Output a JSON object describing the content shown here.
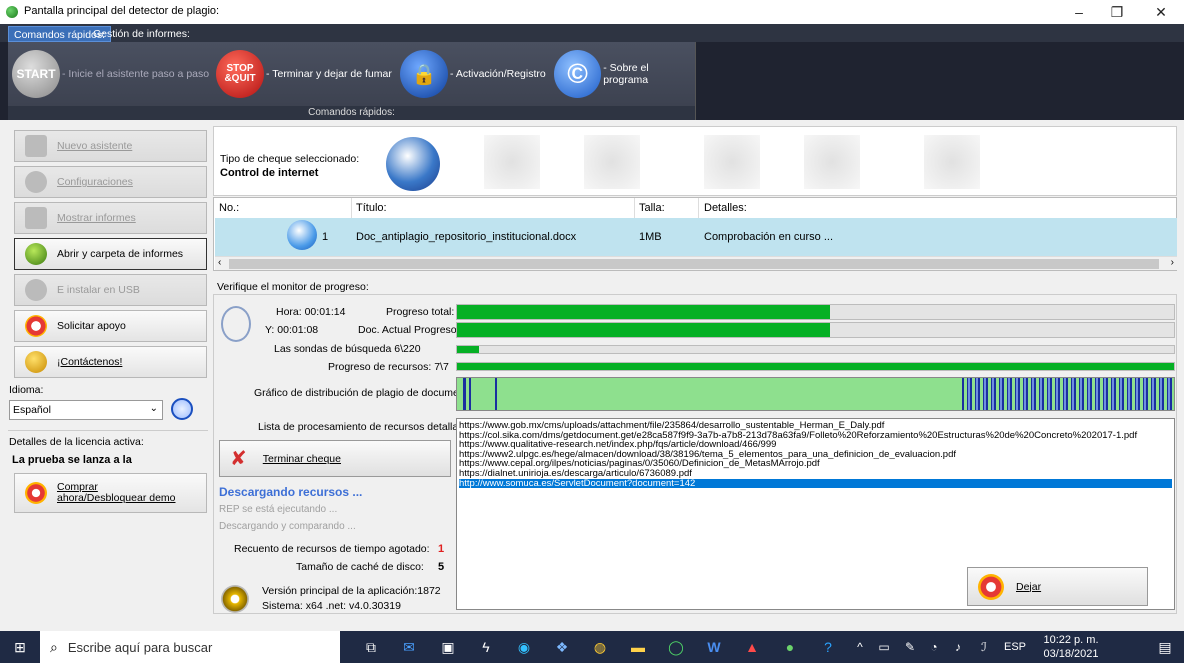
{
  "window": {
    "title": "Pantalla principal del detector de plagio:",
    "minimize": "–",
    "restore": "❐",
    "close": "✕"
  },
  "ribbon": {
    "tabs": [
      "Comandos rápidos:",
      "Gestión de informes:"
    ],
    "group_label": "Comandos rápidos:",
    "commands": [
      {
        "icon": "START",
        "label": "- Inicie el asistente paso a paso"
      },
      {
        "icon": "STOP &QUIT",
        "label": "- Terminar y dejar de fumar"
      },
      {
        "icon": "lock-icon",
        "label": "- Activación/Registro"
      },
      {
        "icon": "copyright-icon",
        "label": "- Sobre el programa"
      }
    ]
  },
  "sidebar": {
    "items": [
      {
        "label": "Nuevo asistente"
      },
      {
        "label": "Configuraciones"
      },
      {
        "label": "Mostrar informes"
      },
      {
        "label": "Abrir y carpeta de informes"
      },
      {
        "label": "E instalar en USB"
      },
      {
        "label": "Solicitar apoyo"
      },
      {
        "label": "¡Contáctenos!"
      }
    ],
    "language_label": "Idioma:",
    "language_value": "Español",
    "license_label": "Detalles de la licencia activa:",
    "license_value": "La prueba se lanza a la",
    "buy_label": "Comprar ahora/Desbloquear demo"
  },
  "check": {
    "type_label": "Tipo de cheque seleccionado:",
    "type_value": "Control de internet"
  },
  "table": {
    "headers": [
      "No.:",
      "Título:",
      "Talla:",
      "Detalles:"
    ],
    "rows": [
      {
        "no": "1",
        "title": "Doc_antiplagio_repositorio_institucional.docx",
        "size": "1MB",
        "details": "Comprobación en curso ..."
      }
    ]
  },
  "monitor": {
    "label": "Verifique el monitor de progreso:",
    "time_label": "Hora: 00:01:14",
    "y_label": "Y: 00:01:08",
    "total_progress_label": "Progreso total:",
    "total_progress": 0.52,
    "doc_progress_label": "Doc. Actual Progreso:",
    "doc_progress": 0.52,
    "probes_label": "Las sondas de búsqueda  6\\220",
    "probes_progress": 0.03,
    "resources_label": "Progreso de recursos:  7\\7",
    "resources_progress": 1.0,
    "distribution_label": "Gráfico de distribución de plagio de documentos",
    "list_label": "Lista de procesamiento de recursos detallados:",
    "resources": [
      "https://www.gob.mx/cms/uploads/attachment/file/235864/desarrollo_sustentable_Herman_E_Daly.pdf",
      "https://col.sika.com/dms/getdocument.get/e28ca587f9f9-3a7b-a7b8-213d78a63fa9/Folleto%20Reforzamiento%20Estructuras%20de%20Concreto%202017-1.pdf",
      "https://www.qualitative-research.net/index.php/fqs/article/download/466/999",
      "https://www2.ulpgc.es/hege/almacen/download/38/38196/tema_5_elementos_para_una_definicion_de_evaluacion.pdf",
      "https://www.cepal.org/ilpes/noticias/paginas/0/35060/Definicion_de_MetasMArrojo.pdf",
      "https://dialnet.unirioja.es/descarga/articulo/6736089.pdf",
      "http://www.somuca.es/ServletDocument?document=142"
    ],
    "stop_button": "Terminar cheque",
    "status_title": "Descargando recursos ...",
    "status_line1": "REP se está ejecutando ...",
    "status_line2": "Descargando y comparando ...",
    "timeout_label": "Recuento de recursos de tiempo agotado:",
    "timeout_value": "1",
    "cache_label": "Tamaño de caché de disco:",
    "cache_value": "5",
    "version_line1": "Versión principal de la aplicación:1872",
    "version_line2": "Sistema: x64 .net: v4.0.30319",
    "quit_button": "Dejar"
  },
  "taskbar": {
    "search_placeholder": "Escribe aquí para buscar",
    "lang": "ESP",
    "time": "10:22 p. m.",
    "date": "03/18/2021"
  }
}
